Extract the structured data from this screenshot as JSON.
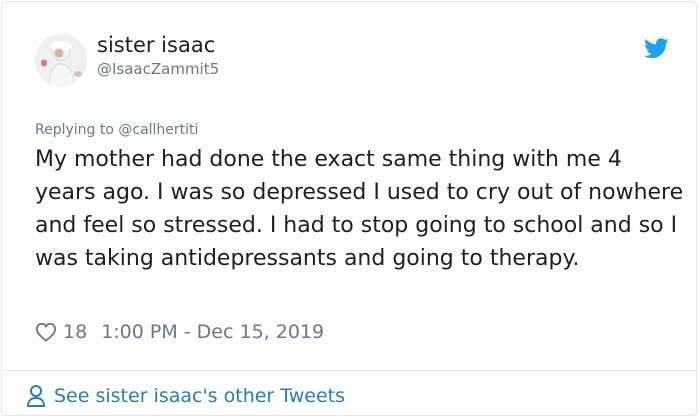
{
  "author": {
    "display_name": "sister isaac",
    "handle": "@IsaacZammit5"
  },
  "reply": {
    "text": "Replying to @callhertiti"
  },
  "tweet": {
    "text": "My mother had done the exact same thing with me 4 years ago. I was so depressed I used to cry out of nowhere and feel so stressed. I had to stop going to school and so I was taking antidepressants and going to therapy."
  },
  "meta": {
    "like_count": "18",
    "timestamp": "1:00 PM - Dec 15, 2019"
  },
  "footer": {
    "link_text": "See sister isaac's other Tweets"
  },
  "icons": {
    "brand": "twitter-bird-icon",
    "like": "heart-icon",
    "profile": "person-icon"
  },
  "colors": {
    "twitter_blue": "#1da1f2",
    "link_blue": "#2b7bb9",
    "text": "#1c2022",
    "muted": "#697882",
    "border": "#e1e8ed"
  }
}
